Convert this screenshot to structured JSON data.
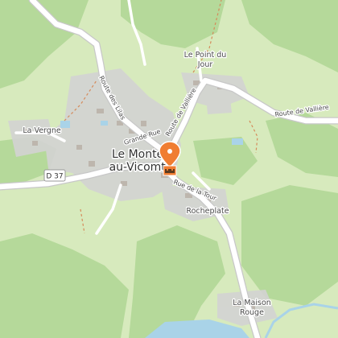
{
  "map": {
    "village": {
      "line1": "Le Monteil",
      "line2": "au-Vicomte"
    },
    "places": {
      "le_point_du_jour_1": "Le Point du",
      "le_point_du_jour_2": "Jour",
      "la_vergne": "La Vergne",
      "rocheplate": "Rocheplate",
      "la_maison_rouge_1": "La Maison",
      "la_maison_rouge_2": "Rouge"
    },
    "roads": {
      "route_des_lilas": "Route des Lilas",
      "route_de_valliere_north": "Route de Vallière",
      "route_de_valliere_east": "Route de Vallière",
      "grande_rue": "Grande Rue",
      "rue_de_la_tour": "Rue de la Tour"
    },
    "road_shield": "D 37",
    "marker": {
      "icon": "castle-icon",
      "color": "#f07d32"
    },
    "colors": {
      "meadow": "#d7eabd",
      "forest": "#b5d99a",
      "built_area": "#d3d3d3",
      "road": "#ffffff",
      "water": "#a9d3e8",
      "path": "#d58a5a"
    }
  }
}
